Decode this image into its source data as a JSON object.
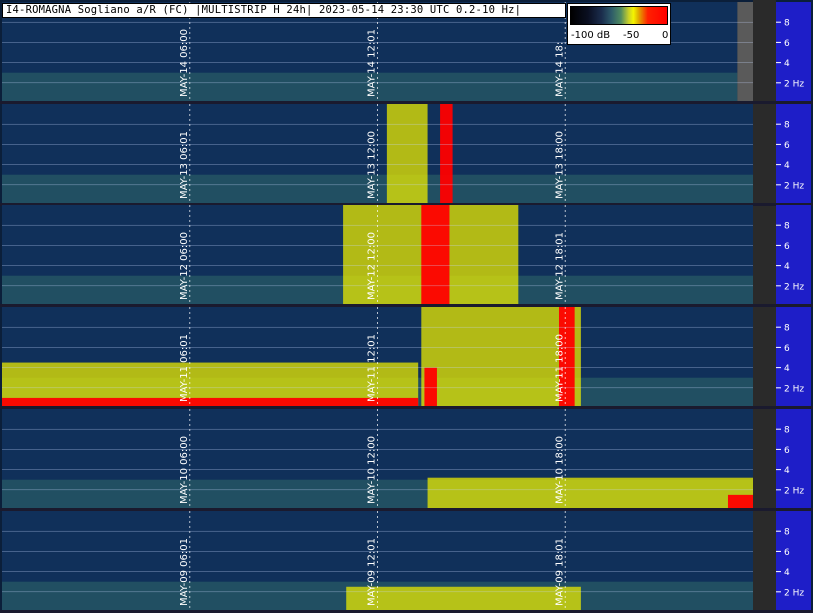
{
  "title": "I4-ROMAGNA Sogliano a/R (FC) |MULTISTRIP H 24h| 2023-05-14 23:30 UTC 0.2-10 Hz|",
  "legend": {
    "labels": [
      "-100 dB",
      "-50",
      "0"
    ],
    "colors": [
      "#000000",
      "#1b2d4d",
      "#2d5a69",
      "#4f8a60",
      "#f5f500",
      "#ff2000"
    ]
  },
  "colors": {
    "axis_panel": "#1e1ec8",
    "background": "#10305a",
    "grid_line": "#c8d8ff",
    "marker_text": "#ffffff",
    "level_low": "#1b3d5a",
    "level_mid": "#2f6a6a",
    "level_high": "#e8e800",
    "level_max": "#ff0000"
  },
  "chart_data": {
    "type": "heatmap",
    "x_unit": "UTC hour of day",
    "y_unit": "Hz",
    "xlim": [
      0,
      24
    ],
    "ylim": [
      0.2,
      10
    ],
    "y_ticks": [
      8,
      6,
      4,
      2
    ],
    "y_tick_labels": [
      "8",
      "6",
      "4",
      "2 Hz"
    ],
    "strips": [
      {
        "date": "2023-05-14",
        "markers": [
          "MAY-14 06:00",
          "MAY-14 12:01",
          "MAY-14 18:"
        ],
        "marker_hours": [
          6,
          12,
          18
        ],
        "end_hour": 23.5,
        "bursts": []
      },
      {
        "date": "2023-05-13",
        "markers": [
          "MAY-13 06:01",
          "MAY-13 12:00",
          "MAY-13 18:00"
        ],
        "marker_hours": [
          6,
          12,
          18
        ],
        "end_hour": 24,
        "bursts": [
          {
            "start_hour": 12.3,
            "end_hour": 13.6,
            "max_hz": 10,
            "level": "high"
          },
          {
            "start_hour": 14.0,
            "end_hour": 14.4,
            "max_hz": 10,
            "level": "max"
          }
        ]
      },
      {
        "date": "2023-05-12",
        "markers": [
          "MAY-12 06:00",
          "MAY-12 12:00",
          "MAY-12 18:01"
        ],
        "marker_hours": [
          6,
          12,
          18
        ],
        "end_hour": 24,
        "bursts": [
          {
            "start_hour": 10.9,
            "end_hour": 16.5,
            "max_hz": 10,
            "level": "high"
          },
          {
            "start_hour": 13.4,
            "end_hour": 14.3,
            "max_hz": 10,
            "level": "max"
          }
        ]
      },
      {
        "date": "2023-05-11",
        "markers": [
          "MAY-11 06:01",
          "MAY-11 12:01",
          "MAY-11 18:00"
        ],
        "marker_hours": [
          6,
          12,
          18
        ],
        "end_hour": 24,
        "bursts": [
          {
            "start_hour": 0,
            "end_hour": 13.3,
            "max_hz": 4.5,
            "level": "high"
          },
          {
            "start_hour": 0,
            "end_hour": 13.3,
            "max_hz": 1.0,
            "level": "max"
          },
          {
            "start_hour": 13.4,
            "end_hour": 18.5,
            "max_hz": 10,
            "level": "high"
          },
          {
            "start_hour": 13.5,
            "end_hour": 13.9,
            "max_hz": 4,
            "level": "max"
          },
          {
            "start_hour": 17.8,
            "end_hour": 18.3,
            "max_hz": 10,
            "level": "max"
          }
        ]
      },
      {
        "date": "2023-05-10",
        "markers": [
          "MAY-10 06:00",
          "MAY-10 12:00",
          "MAY-10 18:00"
        ],
        "marker_hours": [
          6,
          12,
          18
        ],
        "end_hour": 24,
        "bursts": [
          {
            "start_hour": 13.6,
            "end_hour": 24,
            "max_hz": 3.2,
            "level": "high"
          },
          {
            "start_hour": 23.2,
            "end_hour": 24,
            "max_hz": 1.5,
            "level": "max"
          }
        ]
      },
      {
        "date": "2023-05-09",
        "markers": [
          "MAY-09 06:01",
          "MAY-09 12:01",
          "MAY-09 18:01"
        ],
        "marker_hours": [
          6,
          12,
          18
        ],
        "end_hour": 24,
        "bursts": [
          {
            "start_hour": 11.0,
            "end_hour": 18.5,
            "max_hz": 2.5,
            "level": "high"
          }
        ]
      }
    ]
  }
}
